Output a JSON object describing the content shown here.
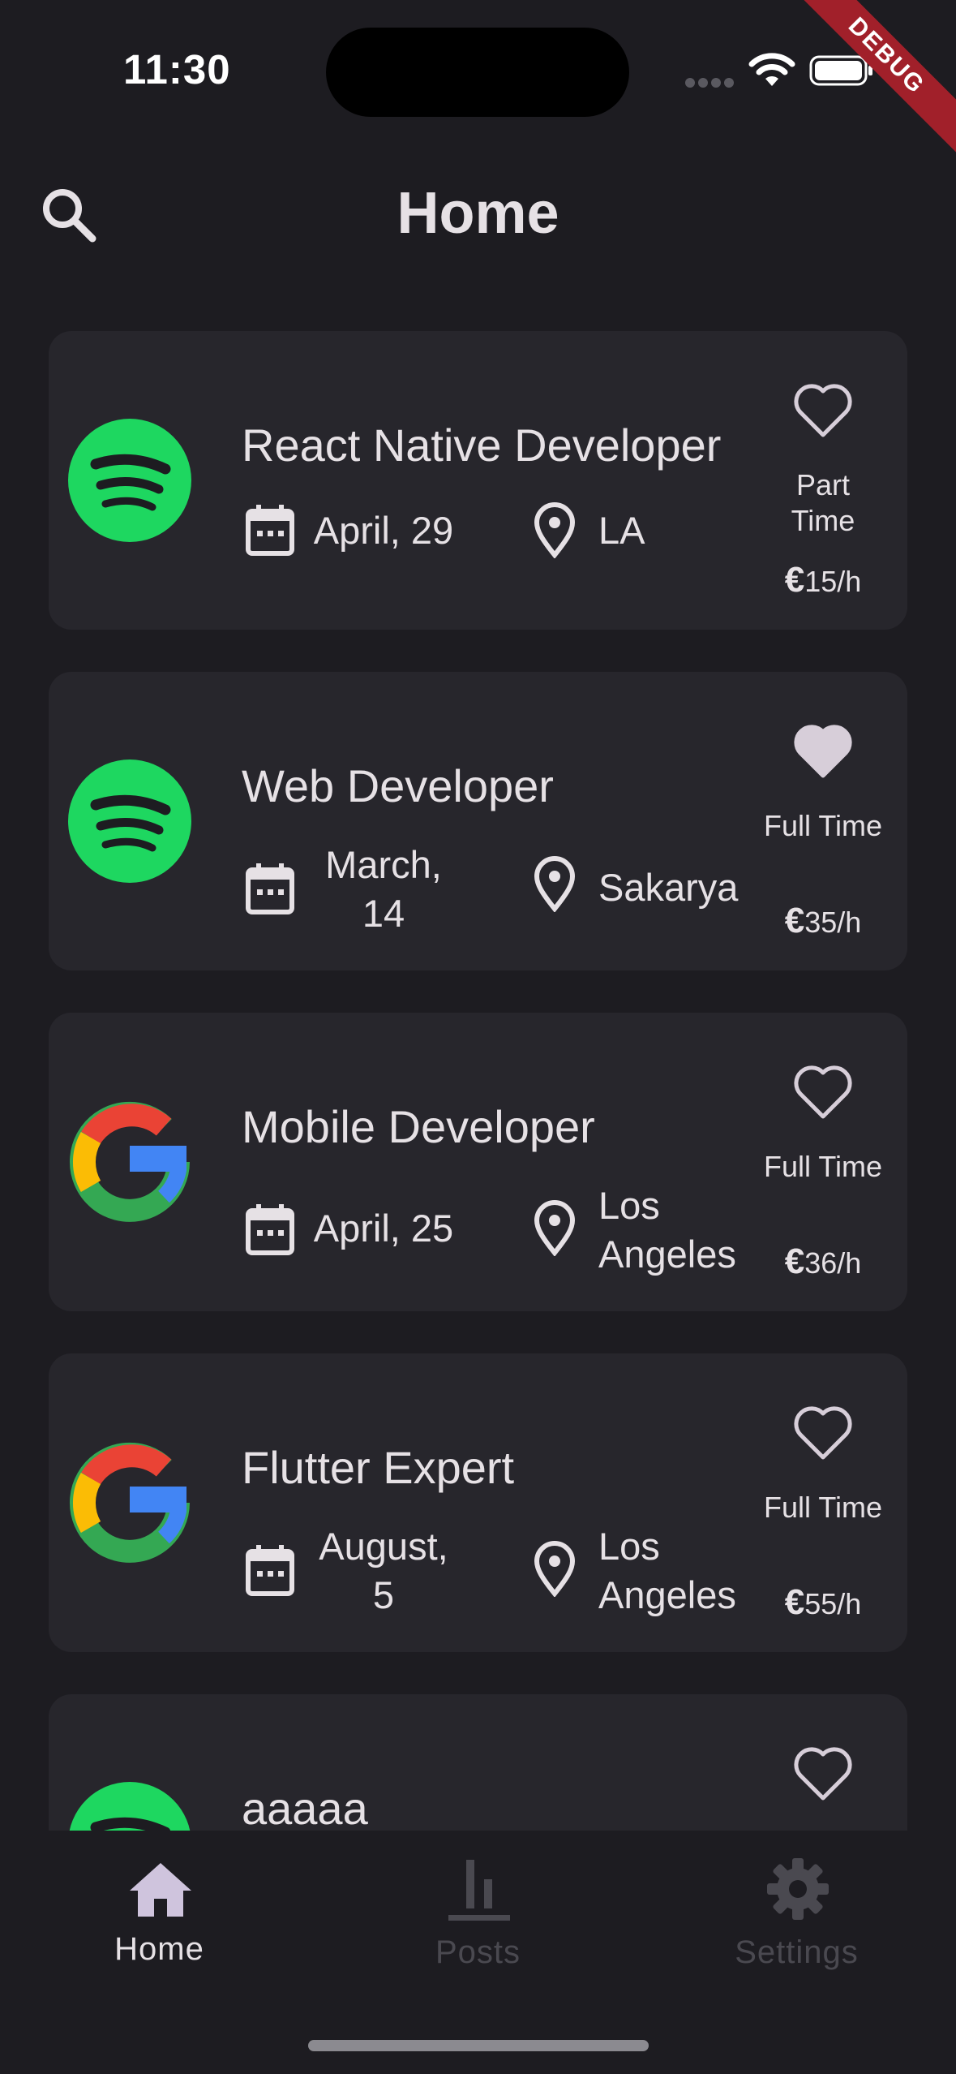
{
  "status_bar": {
    "time": "11:30",
    "debug_label": "DEBUG"
  },
  "app_bar": {
    "title": "Home",
    "search_icon": "search-icon"
  },
  "jobs": [
    {
      "title": "React Native Developer",
      "company_logo": "spotify-logo",
      "date": "April, 29",
      "location": "LA",
      "type": "Part Time",
      "rate": "15/h",
      "favorite": false
    },
    {
      "title": "Web Developer",
      "company_logo": "spotify-logo",
      "date": "March, 14",
      "location": "Sakarya",
      "type": "Full Time",
      "rate": "35/h",
      "favorite": true
    },
    {
      "title": "Mobile Developer",
      "company_logo": "google-logo",
      "date": "April, 25",
      "location": "Los Angeles",
      "type": "Full Time",
      "rate": "36/h",
      "favorite": false
    },
    {
      "title": "Flutter Expert",
      "company_logo": "google-logo",
      "date": "August, 5",
      "location": "Los Angeles",
      "type": "Full Time",
      "rate": "55/h",
      "favorite": false
    },
    {
      "title": "aaaaa",
      "company_logo": "spotify-logo",
      "favorite": false
    }
  ],
  "currency_symbol": "€",
  "bottom_nav": {
    "items": [
      {
        "label": "Home",
        "icon": "home-icon",
        "active": true
      },
      {
        "label": "Posts",
        "icon": "bar-chart-icon",
        "active": false
      },
      {
        "label": "Settings",
        "icon": "gear-icon",
        "active": false
      }
    ]
  },
  "colors": {
    "background": "#1d1c21",
    "card": "#27262c",
    "spotify_green": "#1ed760",
    "active_nav": "#cfc4dd",
    "favorite_fill": "#d7ced9"
  }
}
